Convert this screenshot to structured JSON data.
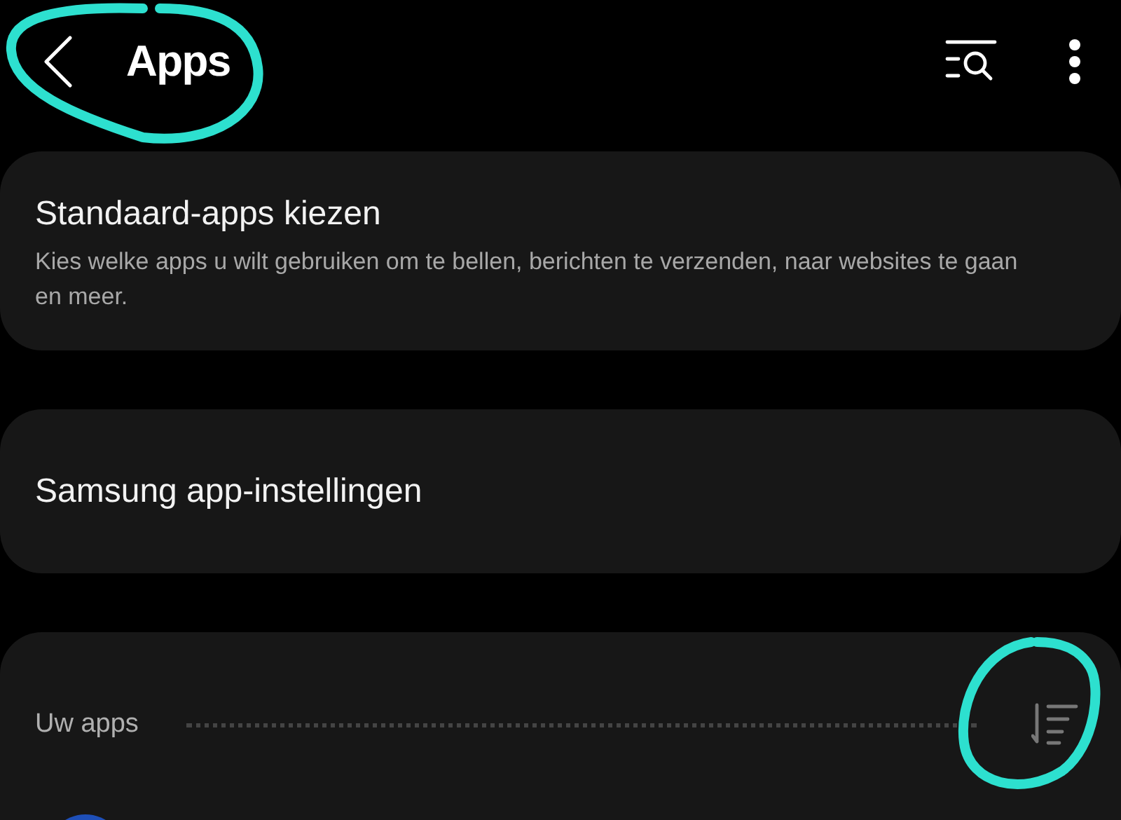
{
  "header": {
    "title": "Apps"
  },
  "cards": [
    {
      "title": "Standaard-apps kiezen",
      "description": "Kies welke apps u wilt gebruiken om te bellen, berichten te verzenden, naar websites te gaan en meer."
    },
    {
      "title": "Samsung app-instellingen"
    }
  ],
  "apps_section": {
    "heading": "Uw apps"
  }
}
